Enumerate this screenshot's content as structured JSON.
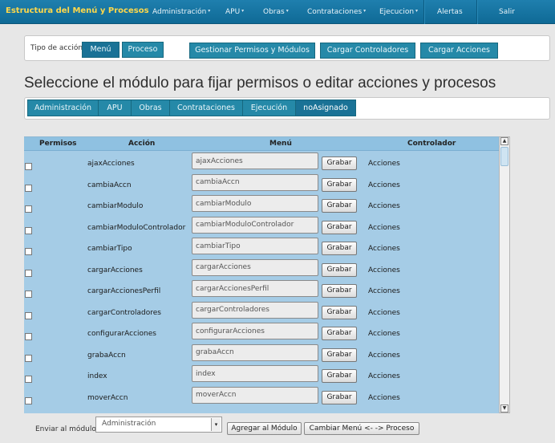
{
  "navbar": {
    "brand": "Estructura del Menú y Procesos",
    "items": [
      {
        "label": "Administración",
        "dropdown": true
      },
      {
        "label": "APU",
        "dropdown": true
      },
      {
        "label": "Obras",
        "dropdown": true
      },
      {
        "label": "Contrataciones",
        "dropdown": true
      },
      {
        "label": "Ejecucion",
        "dropdown": true
      },
      {
        "label": "Alertas",
        "dropdown": false
      },
      {
        "label": "Salir",
        "dropdown": false
      }
    ],
    "caret": "▾"
  },
  "action_panel": {
    "tipo_label": "Tipo de acción",
    "menu_label": "Menú",
    "proceso_label": "Proceso",
    "gestionar_label": "Gestionar Permisos y Módulos",
    "cargar_controladores_label": "Cargar Controladores",
    "cargar_acciones_label": "Cargar Acciones"
  },
  "page_title": "Seleccione el módulo para fijar permisos o editar acciones y procesos",
  "module_tabs": [
    {
      "label": "Administración",
      "active": false
    },
    {
      "label": "APU",
      "active": false
    },
    {
      "label": "Obras",
      "active": false
    },
    {
      "label": "Contrataciones",
      "active": false
    },
    {
      "label": "Ejecución",
      "active": false
    },
    {
      "label": "noAsignado",
      "active": true
    }
  ],
  "table": {
    "headers": [
      "Permisos",
      "Acción",
      "Menú",
      "Controlador"
    ],
    "save_label": "Grabar",
    "rows": [
      {
        "accion": "ajaxAcciones",
        "menu": "ajaxAcciones",
        "controlador": "Acciones"
      },
      {
        "accion": "cambiaAccn",
        "menu": "cambiaAccn",
        "controlador": "Acciones"
      },
      {
        "accion": "cambiarModulo",
        "menu": "cambiarModulo",
        "controlador": "Acciones"
      },
      {
        "accion": "cambiarModuloControlador",
        "menu": "cambiarModuloControlador",
        "controlador": "Acciones"
      },
      {
        "accion": "cambiarTipo",
        "menu": "cambiarTipo",
        "controlador": "Acciones"
      },
      {
        "accion": "cargarAcciones",
        "menu": "cargarAcciones",
        "controlador": "Acciones"
      },
      {
        "accion": "cargarAccionesPerfil",
        "menu": "cargarAccionesPerfil",
        "controlador": "Acciones"
      },
      {
        "accion": "cargarControladores",
        "menu": "cargarControladores",
        "controlador": "Acciones"
      },
      {
        "accion": "configurarAcciones",
        "menu": "configurarAcciones",
        "controlador": "Acciones"
      },
      {
        "accion": "grabaAccn",
        "menu": "grabaAccn",
        "controlador": "Acciones"
      },
      {
        "accion": "index",
        "menu": "index",
        "controlador": "Acciones"
      },
      {
        "accion": "moverAccn",
        "menu": "moverAccn",
        "controlador": "Acciones"
      }
    ]
  },
  "footer": {
    "enviar_label": "Enviar al módulo:",
    "select_value": "Administración",
    "agregar_label": "Agregar al Módulo",
    "cambiar_label": "Cambiar Menú <- -> Proceso"
  },
  "icons": {
    "scroll_up": "▲",
    "scroll_down": "▼",
    "select_arrow": "▾"
  },
  "colors": {
    "navbar": "#1579a8",
    "brand": "#ffd84a",
    "teal_button": "#2589a8",
    "table_bg": "#a5cce6"
  }
}
